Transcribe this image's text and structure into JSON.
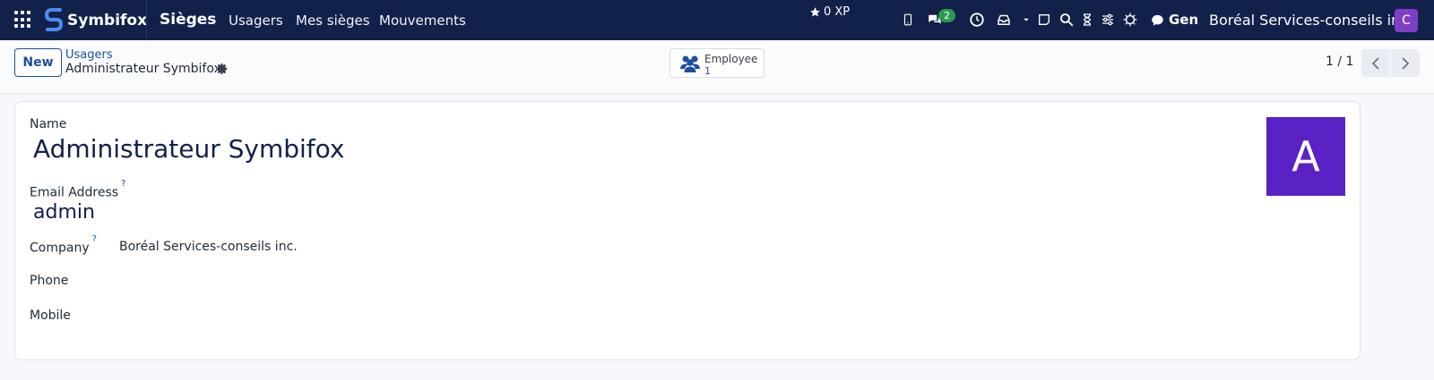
{
  "topbar": {
    "brand": "Symbifox",
    "app_name": "Sièges",
    "menu": [
      "Usagers",
      "Mes sièges",
      "Mouvements"
    ],
    "xp": "0 XP",
    "chat_badge": "2",
    "gen": "Gen",
    "company": "Boréal Services-conseils inc.",
    "user_initial": "C"
  },
  "control": {
    "new_label": "New",
    "breadcrumb_parent": "Usagers",
    "breadcrumb_current": "Administrateur Symbifox",
    "smart_button_label": "Employee",
    "smart_button_count": "1",
    "pager": "1 / 1"
  },
  "form": {
    "name_label": "Name",
    "name_value": "Administrateur Symbifox",
    "email_label": "Email Address",
    "email_value": "admin",
    "company_label": "Company",
    "company_value": "Boréal Services-conseils inc.",
    "phone_label": "Phone",
    "mobile_label": "Mobile",
    "help_mark": "?",
    "avatar_letter": "A"
  },
  "colors": {
    "topbar": "#12214a",
    "link": "#1e4ea1",
    "avatar": "#5a22c4",
    "user_avatar": "#7e3fc4",
    "badge": "#2c9a4e"
  }
}
